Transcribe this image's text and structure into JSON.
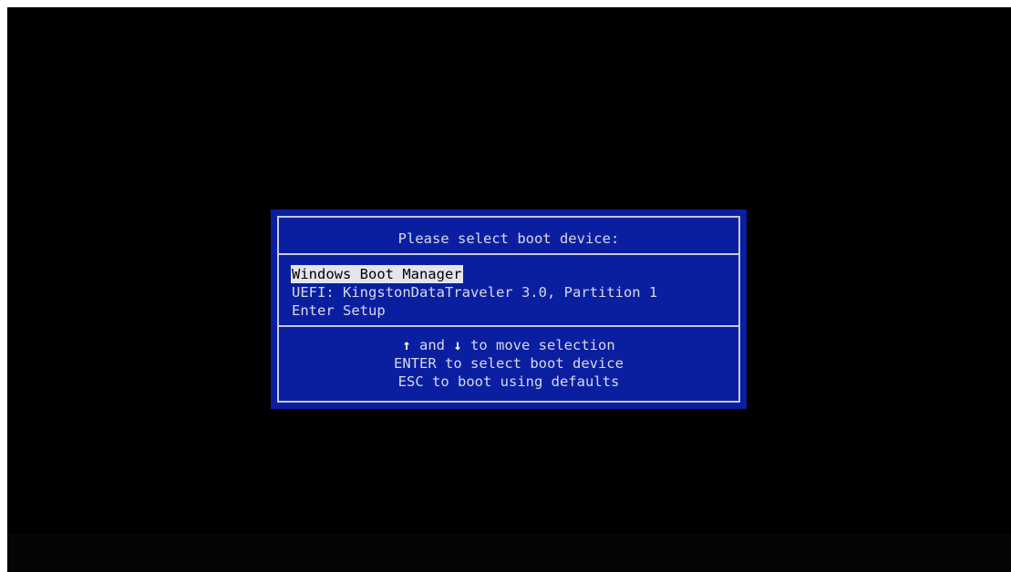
{
  "boot_menu": {
    "title": "Please select boot device:",
    "devices": [
      {
        "label": "Windows Boot Manager",
        "selected": true
      },
      {
        "label": "UEFI: KingstonDataTraveler 3.0, Partition 1",
        "selected": false
      },
      {
        "label": "Enter Setup",
        "selected": false
      }
    ],
    "help": {
      "line1": {
        "up_arrow": "↑",
        "and_text": " and ",
        "down_arrow": "↓",
        "rest_text": " to move selection"
      },
      "line2": "ENTER to select boot device",
      "line3": "ESC to boot using defaults"
    }
  },
  "colors": {
    "screen_background": "#000000",
    "dialog_background": "#0a1fa0",
    "dialog_text": "#d8d8e4",
    "selection_background": "#e4e4ee",
    "selection_text": "#000000"
  }
}
